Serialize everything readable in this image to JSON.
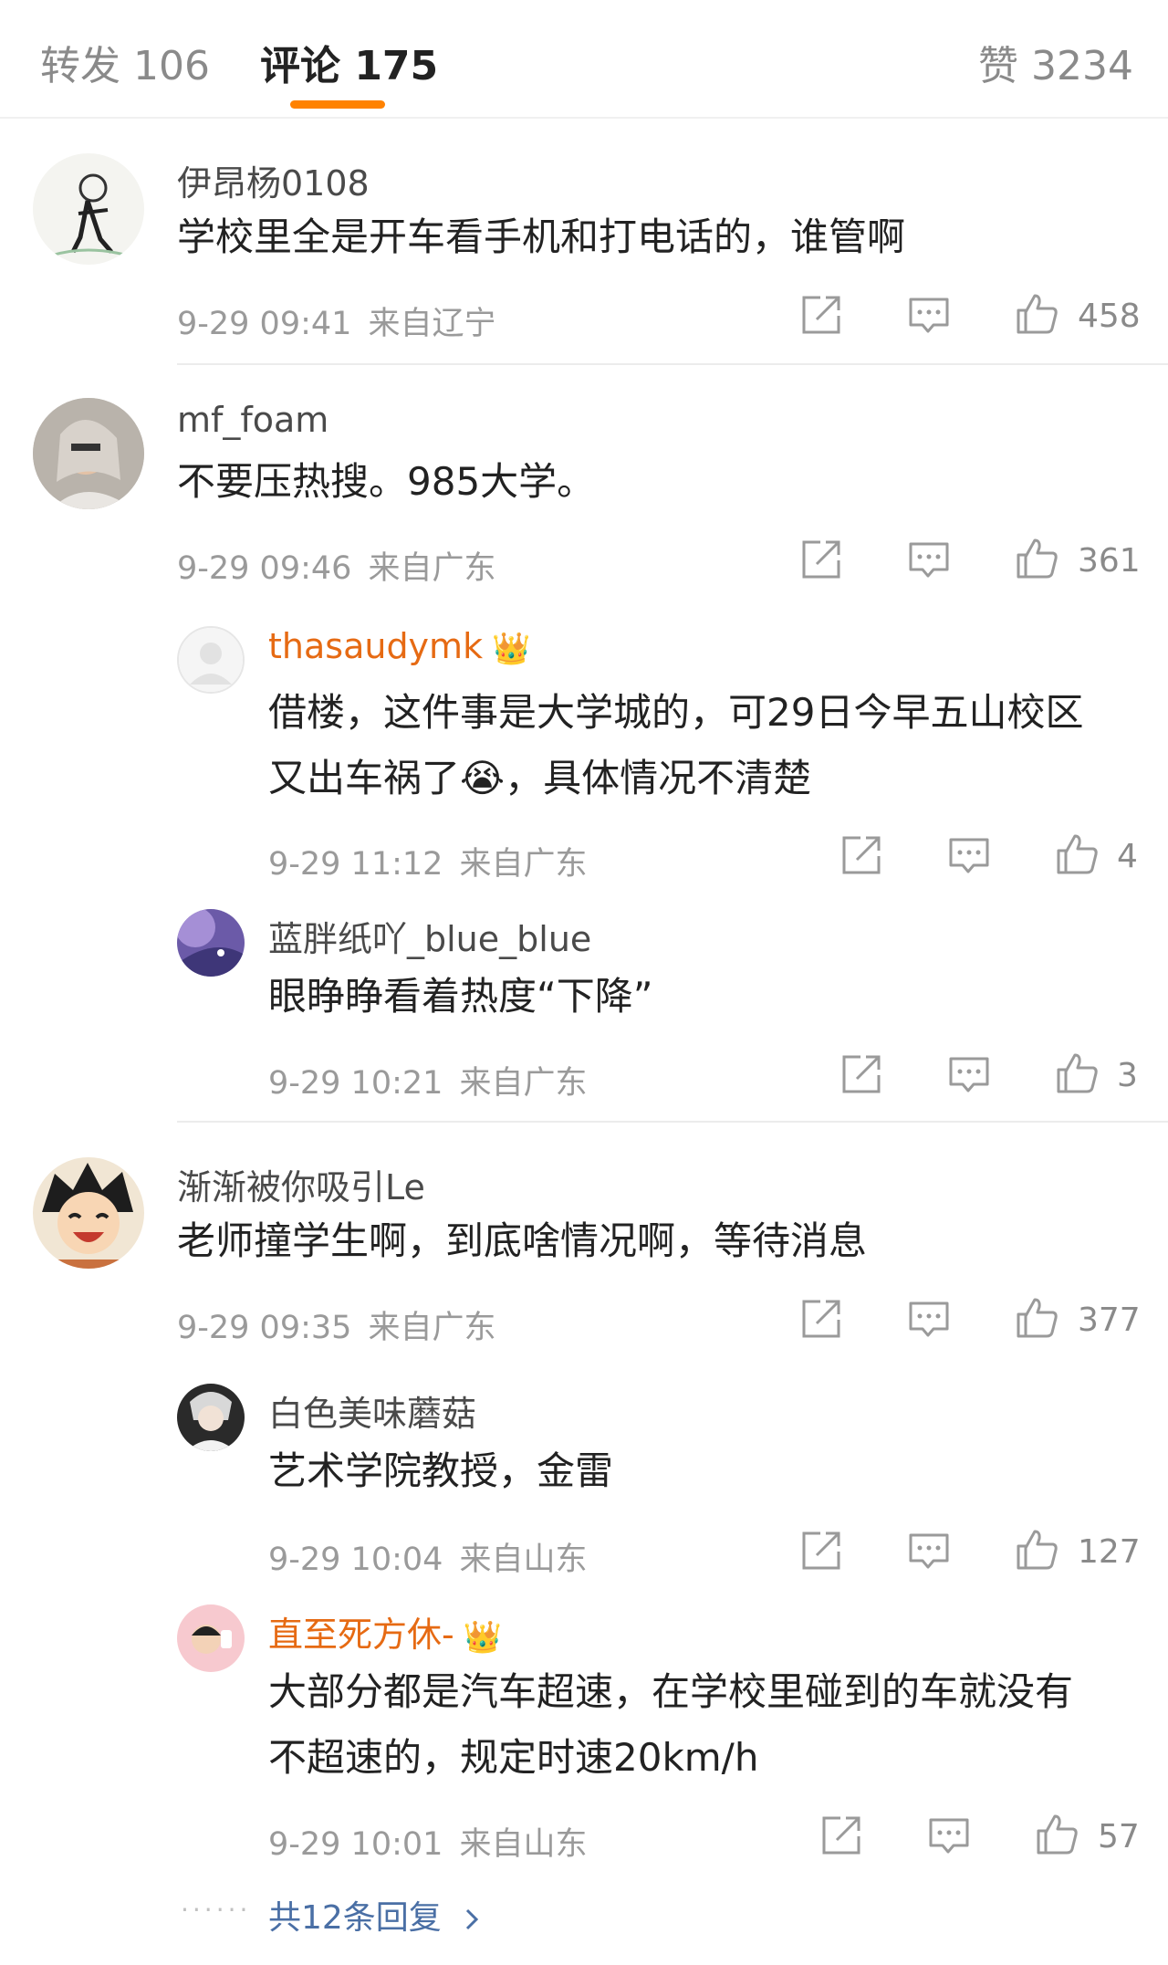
{
  "tabs": {
    "repost": "转发 106",
    "comments": "评论 175",
    "likes": "赞 3234"
  },
  "comments": [
    {
      "user": "伊昂杨0108",
      "text": "学校里全是开车看手机和打电话的，谁管啊",
      "time": "9-29 09:41",
      "location": "来自辽宁",
      "likes": "458"
    },
    {
      "user": "mf_foam",
      "text": "不要压热搜。985大学。",
      "time": "9-29 09:46",
      "location": "来自广东",
      "likes": "361",
      "replies": [
        {
          "user": "thasaudymk",
          "badge": "crown",
          "text_line1": "借楼，这件事是大学城的，可29日今早五山校区",
          "text_line2": "又出车祸了😭，具体情况不清楚",
          "time": "9-29 11:12",
          "location": "来自广东",
          "likes": "4"
        },
        {
          "user": "蓝胖纸吖_blue_blue",
          "text": "眼睁睁看着热度“下降”",
          "time": "9-29 10:21",
          "location": "来自广东",
          "likes": "3"
        }
      ]
    },
    {
      "user": "渐渐被你吸引Le",
      "text": "老师撞学生啊，到底啥情况啊，等待消息",
      "time": "9-29 09:35",
      "location": "来自广东",
      "likes": "377",
      "replies": [
        {
          "user": "白色美味蘑菇",
          "text": "艺术学院教授，金雷",
          "time": "9-29 10:04",
          "location": "来自山东",
          "likes": "127"
        },
        {
          "user": "直至死方休-",
          "badge": "crown",
          "text_line1": "大部分都是汽车超速，在学校里碰到的车就没有",
          "text_line2": "不超速的，规定时速20km/h",
          "time": "9-29 10:01",
          "location": "来自山东",
          "likes": "57"
        }
      ],
      "more_replies": "共12条回复",
      "more_replies_dots": "······"
    }
  ],
  "icons": {
    "share": "share-icon",
    "comment": "comment-icon",
    "like": "thumbs-up-icon",
    "badge": "crown-badge-icon",
    "chevron": "chevron-right-icon"
  },
  "colors": {
    "accent": "#ff8200",
    "vip_name": "#e66a13",
    "link": "#4a6fa5"
  }
}
